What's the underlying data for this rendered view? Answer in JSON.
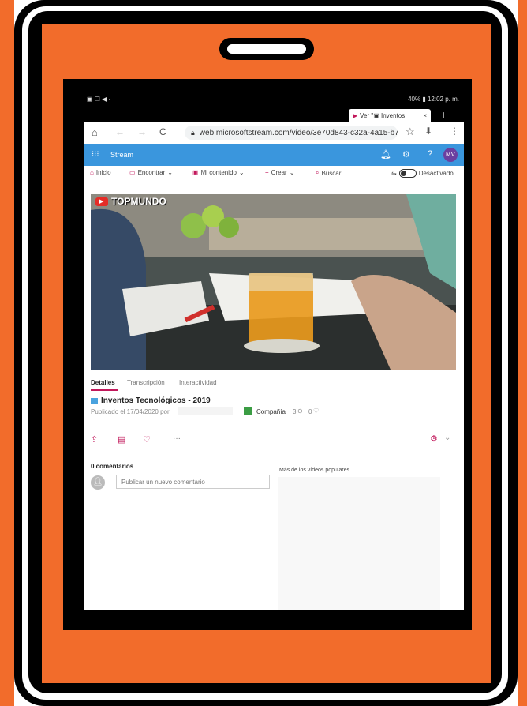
{
  "status": {
    "left": "▣ ☐ ◀ ·",
    "right": "40% ▮ 12:02 p. m."
  },
  "tab": {
    "title": "Ver \"▣ Inventos",
    "close": "×",
    "new": "+"
  },
  "browser": {
    "url": "web.microsoftstream.com/video/3e70d843-c32a-4a15-b7b7"
  },
  "stream": {
    "app_name": "Stream",
    "avatar": "MV"
  },
  "nav": {
    "inicio": "Inicio",
    "encontrar": "Encontrar",
    "mi_contenido": "Mi contenido",
    "crear": "Crear",
    "buscar": "Buscar",
    "toggle_label": "Desactivado"
  },
  "video": {
    "watermark": "TOPMUNDO"
  },
  "tabs": {
    "detalles": "Detalles",
    "transcripcion": "Transcripción",
    "interactividad": "Interactividad"
  },
  "details": {
    "title": "Inventos Tecnológicos - 2019",
    "published": "Publicado el 17/04/2020 por",
    "company": "Compañía",
    "views": "3",
    "likes": "0"
  },
  "actions": {
    "more": "···"
  },
  "comments": {
    "heading": "0 comentarios",
    "placeholder": "Publicar un nuevo comentario"
  },
  "popular": {
    "heading": "Más de los vídeos populares"
  },
  "colors": {
    "orange": "#f26c2b",
    "stream_blue": "#3a96dd",
    "accent_pink": "#c2185b",
    "avatar_purple": "#6b3fa0"
  }
}
